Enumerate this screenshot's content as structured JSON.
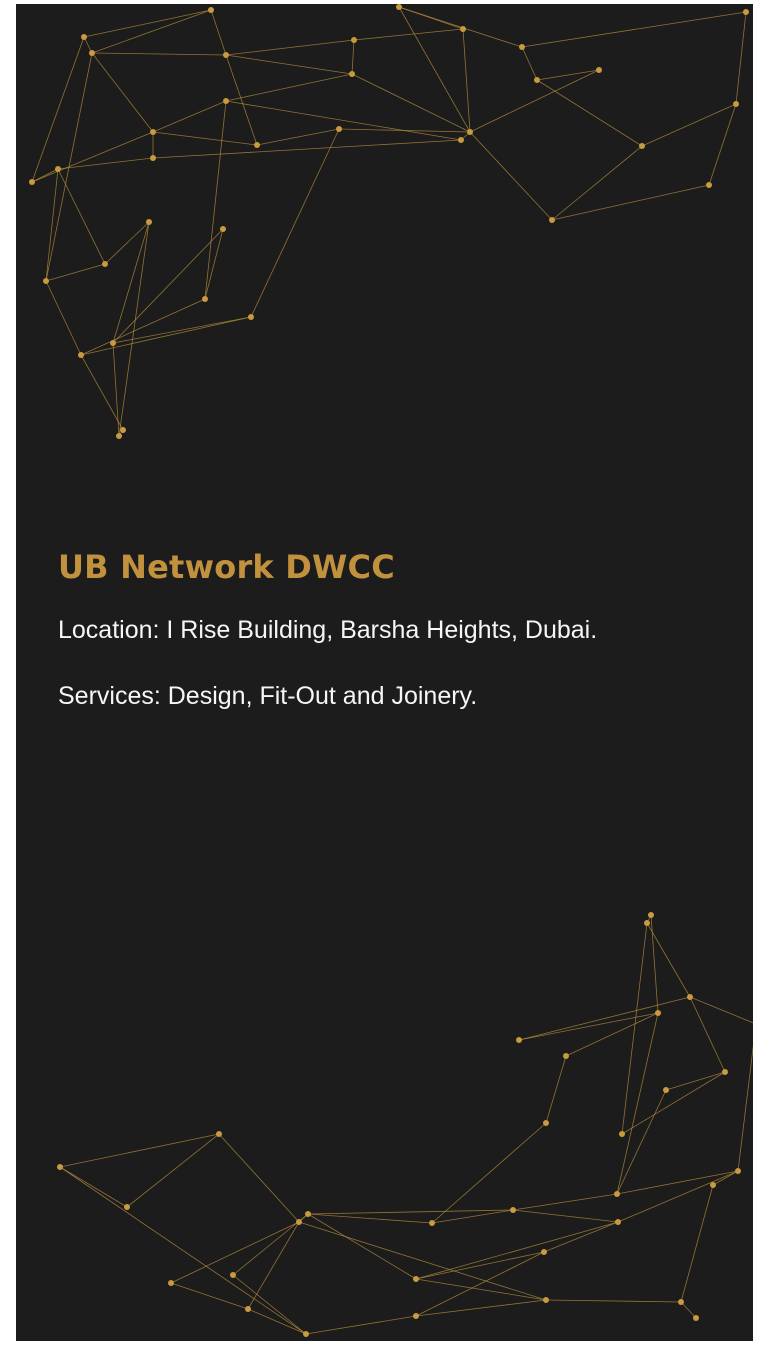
{
  "project": {
    "title": "UB Network DWCC",
    "location": "Location: I Rise Building, Barsha Heights, Dubai.",
    "services": "Services: Design, Fit-Out and Joinery."
  },
  "decoration": {
    "top": "network-graphic",
    "bottom": "network-graphic"
  },
  "colors": {
    "background": "#1c1c1c",
    "accent": "#c1913d",
    "text": "#f6f6f6"
  }
}
